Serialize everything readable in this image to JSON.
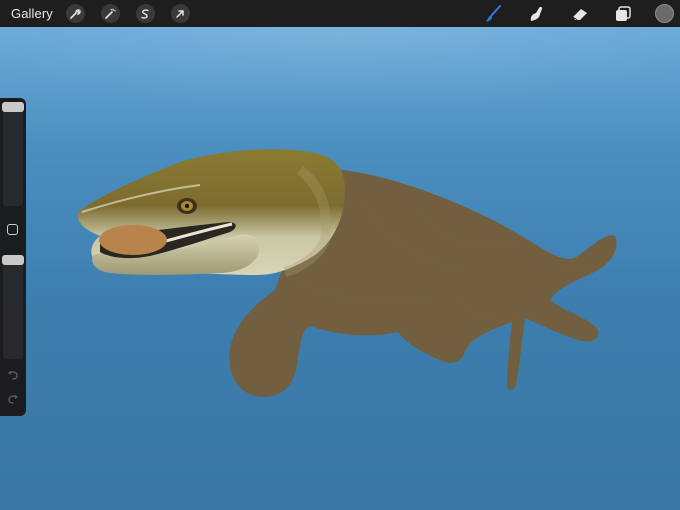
{
  "toolbar": {
    "gallery_label": "Gallery",
    "left_tools": [
      {
        "name": "actions",
        "icon": "wrench-icon"
      },
      {
        "name": "adjustments",
        "icon": "magic-wand-icon"
      },
      {
        "name": "selection",
        "icon": "selection-s-icon"
      },
      {
        "name": "transform",
        "icon": "arrow-cursor-icon"
      }
    ],
    "right_tools": [
      {
        "name": "brush",
        "icon": "brush-icon",
        "active": true
      },
      {
        "name": "smudge",
        "icon": "smudge-icon"
      },
      {
        "name": "eraser",
        "icon": "eraser-icon"
      },
      {
        "name": "layers",
        "icon": "layers-icon"
      },
      {
        "name": "color",
        "icon": "color-swatch"
      }
    ],
    "active_color": "#2f7be0",
    "current_color": "#6b6b6b"
  },
  "sidebar": {
    "brush_size": 1.0,
    "opacity": 1.0,
    "modify_button": "square-icon",
    "undo": "undo-icon",
    "redo": "redo-icon"
  },
  "canvas": {
    "background_top": "#6aa9d8",
    "background_bottom": "#3a76a2",
    "creature_flat_color": "#725f3f",
    "creature_head_color": "#8a7a3a",
    "food_item_color": "#b9834c"
  }
}
